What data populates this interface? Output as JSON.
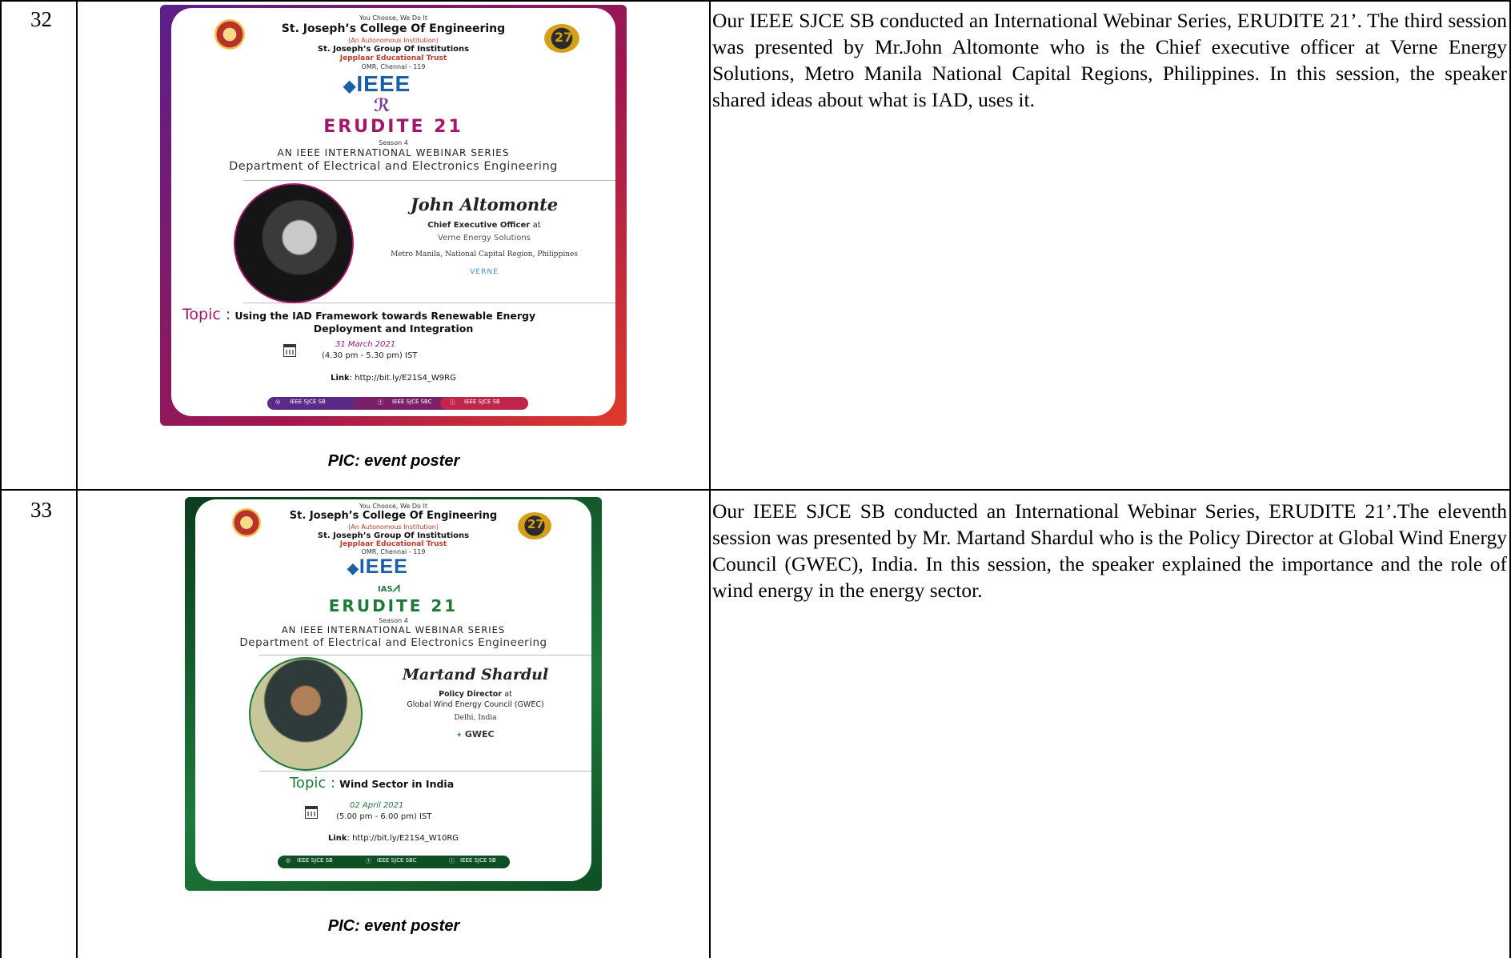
{
  "rows": [
    {
      "number": "32",
      "description": "Our IEEE SJCE SB conducted an International Webinar Series, ERUDITE 21’. The third session was presented by Mr.John Altomonte who is the Chief executive officer at Verne Energy Solutions, Metro Manila National Capital Regions, Philippines. In this session, the speaker shared ideas about what is  IAD, uses it.",
      "caption": "PIC: event poster",
      "poster": {
        "tagline": "You Choose, We Do It",
        "college": "St. Joseph’s College Of Engineering",
        "autonomous": "(An Autonomous Institution)",
        "group": "St. Joseph’s Group Of Institutions",
        "trust": "Jepplaar Educational Trust",
        "address": "OMR, Chennai - 119",
        "ieee": "IEEE",
        "society": "IEEE Robotics & Automation Society",
        "badge": "27",
        "event": "ERUDITE 21",
        "season": "Season 4",
        "series": "AN IEEE INTERNATIONAL WEBINAR SERIES",
        "department": "Department of Electrical and Electronics Engineering",
        "speaker": "John Altomonte",
        "role": "Chief Executive Officer",
        "role_suffix": "at",
        "organization": "Verne Energy Solutions",
        "place": "Metro Manila, National Capital Region, Philippines",
        "org_logo": "VERNE",
        "topic_label": "Topic :",
        "topic": "Using the IAD Framework towards Renewable Energy",
        "topic2": "Deployment and Integration",
        "date": "31 March 2021",
        "time": "(4.30 pm - 5.30 pm) IST",
        "link_label": "Link",
        "link": ": http://bit.ly/E21S4_W9RG",
        "social": [
          "IEEE SJCE SB",
          "IEEE SJCE SBC",
          "IEEE SJCE SB"
        ],
        "accent": "#8e1d5e"
      }
    },
    {
      "number": "33",
      "description": "Our IEEE SJCE SB conducted an International Webinar Series, ERUDITE 21’.The eleventh session was presented by Mr. Martand Shardul who is the Policy Director at Global Wind Energy Council (GWEC), India. In this session, the speaker explained the importance and the role of wind energy in the energy sector.",
      "caption": "PIC: event poster",
      "poster": {
        "tagline": "You Choose, We Do It",
        "college": "St. Joseph’s College Of Engineering",
        "autonomous": "(An Autonomous Institution)",
        "group": "St. Joseph’s Group Of Institutions",
        "trust": "Jepplaar Educational Trust",
        "address": "OMR, Chennai - 119",
        "ieee": "IEEE",
        "society": "IAS",
        "badge": "27",
        "event": "ERUDITE 21",
        "season": "Season 4",
        "series": "AN IEEE INTERNATIONAL WEBINAR SERIES",
        "department": "Department of Electrical and Electronics Engineering",
        "speaker": "Martand Shardul",
        "role": "Policy Director",
        "role_suffix": "at",
        "organization": "Global Wind Energy Council (GWEC)",
        "place": "Delhi, India",
        "org_logo": "GWEC",
        "topic_label": "Topic :",
        "topic": "Wind Sector in India",
        "date": "02 April 2021",
        "time": "(5.00 pm - 6.00 pm) IST",
        "link_label": "Link",
        "link": ": http://bit.ly/E21S4_W10RG",
        "social": [
          "IEEE SJCE SB",
          "IEEE SJCE SBC",
          "IEEE SJCE SB"
        ],
        "accent": "#1e7a3a"
      }
    }
  ]
}
